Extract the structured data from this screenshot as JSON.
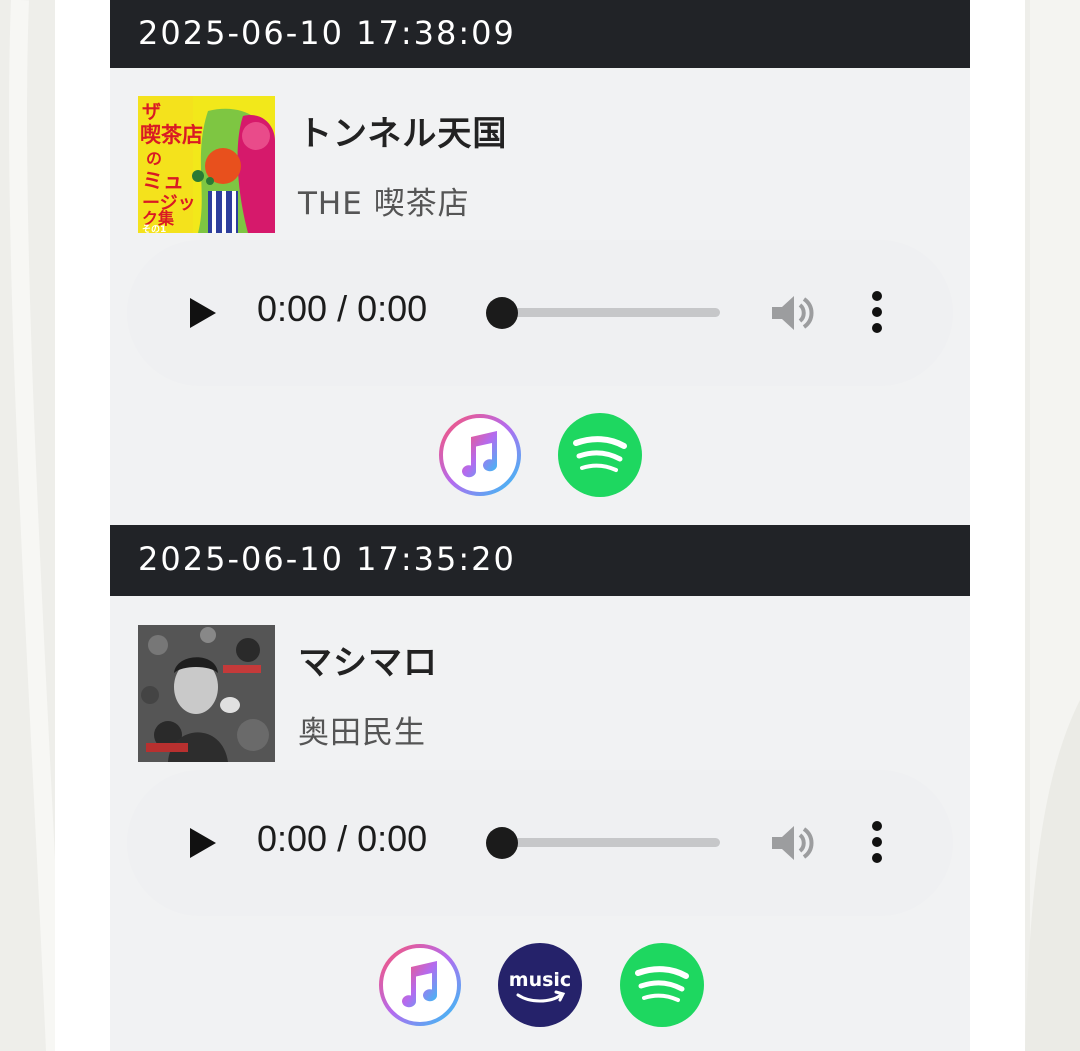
{
  "colors": {
    "header_bg": "#212327",
    "card_bg": "#f1f2f3",
    "player_bg": "#eff0f2",
    "spotify_green": "#1ed760",
    "amazon_navy": "#25226a"
  },
  "entries": [
    {
      "timestamp": "2025-06-10 17:38:09",
      "title": "トンネル天国",
      "artist": "THE 喫茶店",
      "cover_icon": "album-cover",
      "cover_text": "ザ・喫茶店のミュージック集 その1",
      "player": {
        "time": "0:00 / 0:00",
        "progress": 0
      },
      "links": [
        "apple-music-icon",
        "spotify-icon"
      ]
    },
    {
      "timestamp": "2025-06-10 17:35:20",
      "title": "マシマロ",
      "artist": "奥田民生",
      "cover_icon": "album-cover",
      "player": {
        "time": "0:00 / 0:00",
        "progress": 0
      },
      "links": [
        "apple-music-icon",
        "amazon-music-icon",
        "spotify-icon"
      ],
      "amazon_label": "music"
    }
  ]
}
